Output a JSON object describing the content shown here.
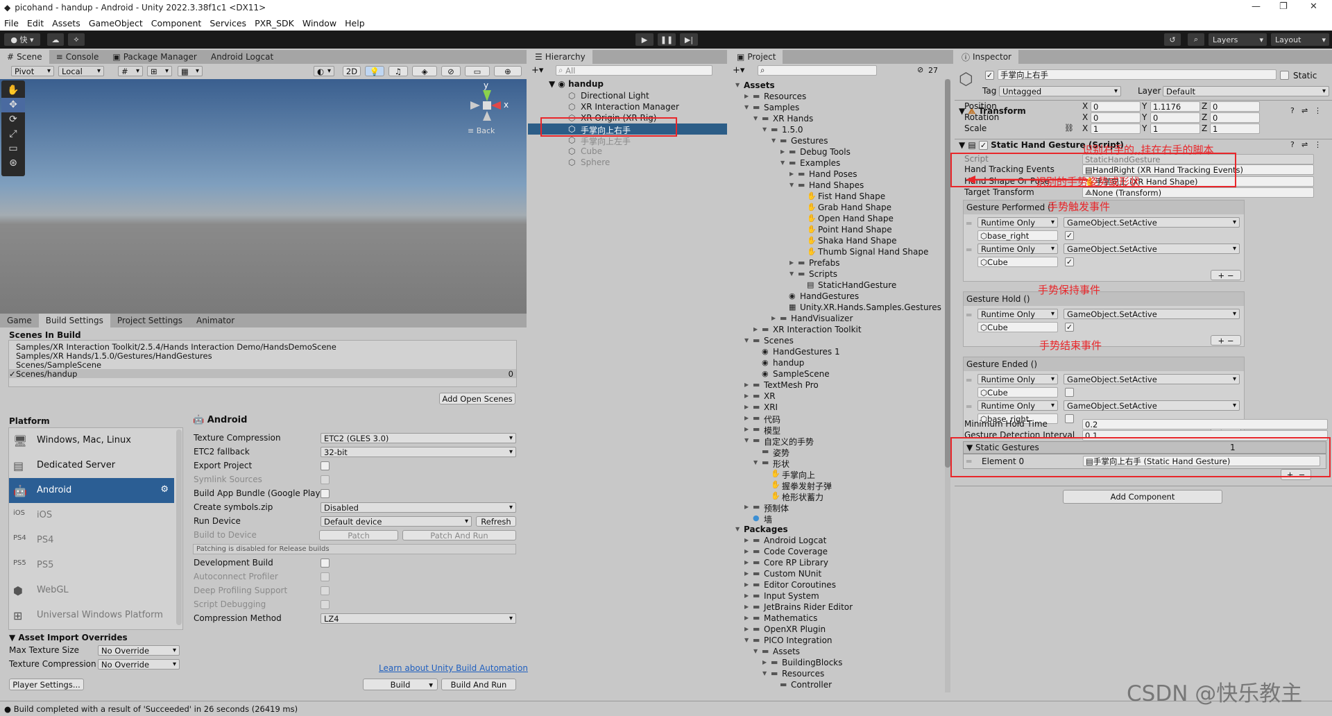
{
  "window": {
    "title": "picohand - handup - Android - Unity 2022.3.38f1c1 <DX11>",
    "controls": [
      "—",
      "❐",
      "✕"
    ]
  },
  "menu": [
    "File",
    "Edit",
    "Assets",
    "GameObject",
    "Component",
    "Services",
    "PXR_SDK",
    "Window",
    "Help"
  ],
  "toolbar": {
    "account": "快",
    "layers": "Layers",
    "layout": "Layout",
    "play": "▶",
    "pause": "❚❚",
    "step": "▶|"
  },
  "scene": {
    "tabs": [
      "Scene",
      "Console",
      "Package Manager",
      "Android Logcat"
    ],
    "pivot": "Pivot",
    "local": "Local",
    "mode2d": "2D",
    "back": "Back",
    "gizmo_y": "y",
    "gizmo_x": "x"
  },
  "build": {
    "tabs": [
      "Game",
      "Build Settings",
      "Project Settings",
      "Animator"
    ],
    "scenes_header": "Scenes In Build",
    "scenes": [
      {
        "path": "Samples/XR Interaction Toolkit/2.5.4/Hands Interaction Demo/HandsDemoScene",
        "checked": false,
        "index": ""
      },
      {
        "path": "Samples/XR Hands/1.5.0/Gestures/HandGestures",
        "checked": false,
        "index": ""
      },
      {
        "path": "Scenes/SampleScene",
        "checked": false,
        "index": ""
      },
      {
        "path": "Scenes/handup",
        "checked": true,
        "index": "0"
      }
    ],
    "add_open_scenes": "Add Open Scenes",
    "platform_header": "Platform",
    "platforms": [
      {
        "name": "Windows, Mac, Linux",
        "icon": "monitor-icon"
      },
      {
        "name": "Dedicated Server",
        "icon": "server-icon"
      },
      {
        "name": "Android",
        "icon": "android-icon"
      },
      {
        "name": "iOS",
        "icon": "ios-icon"
      },
      {
        "name": "PS4",
        "icon": "ps4-icon"
      },
      {
        "name": "PS5",
        "icon": "ps5-icon"
      },
      {
        "name": "WebGL",
        "icon": "webgl-icon"
      },
      {
        "name": "Universal Windows Platform",
        "icon": "windows-icon"
      }
    ],
    "selected_platform": "Android",
    "settings_title": "Android",
    "settings": [
      {
        "label": "Texture Compression",
        "type": "dd",
        "value": "ETC2 (GLES 3.0)"
      },
      {
        "label": "ETC2 fallback",
        "type": "dd",
        "value": "32-bit"
      },
      {
        "label": "Export Project",
        "type": "cb",
        "value": ""
      },
      {
        "label": "Symlink Sources",
        "type": "cb",
        "value": "",
        "disabled": true
      },
      {
        "label": "Build App Bundle (Google Play)",
        "type": "cb",
        "value": ""
      },
      {
        "label": "Create symbols.zip",
        "type": "dd",
        "value": "Disabled"
      },
      {
        "label": "Run Device",
        "type": "device",
        "value": "Default device"
      },
      {
        "label": "Build to Device",
        "type": "patch",
        "value": "",
        "disabled": true
      },
      {
        "label": "Patching is disabled for Release builds",
        "type": "note",
        "value": ""
      },
      {
        "label": "Development Build",
        "type": "cb",
        "value": ""
      },
      {
        "label": "Autoconnect Profiler",
        "type": "cb",
        "value": "",
        "disabled": true
      },
      {
        "label": "Deep Profiling Support",
        "type": "cb",
        "value": "",
        "disabled": true
      },
      {
        "label": "Script Debugging",
        "type": "cb",
        "value": "",
        "disabled": true
      },
      {
        "label": "Compression Method",
        "type": "dd",
        "value": "LZ4"
      }
    ],
    "refresh": "Refresh",
    "patch": "Patch",
    "patch_and_run": "Patch And Run",
    "asset_overrides": "Asset Import Overrides",
    "max_texture_size_label": "Max Texture Size",
    "max_texture_size": "No Override",
    "texture_compression_label": "Texture Compression",
    "texture_compression": "No Override",
    "learn_link": "Learn about Unity Build Automation",
    "player_settings": "Player Settings...",
    "build_btn": "Build",
    "build_and_run": "Build And Run"
  },
  "hierarchy": {
    "tab": "Hierarchy",
    "search": "All",
    "root": "handup",
    "items": [
      {
        "name": "Directional Light",
        "grey": false
      },
      {
        "name": "XR Interaction Manager",
        "grey": false
      },
      {
        "name": "XR Origin (XR Rig)",
        "grey": false
      },
      {
        "name": "手掌向上右手",
        "grey": false,
        "selected": true
      },
      {
        "name": "手掌向上左手",
        "grey": true
      },
      {
        "name": "Cube",
        "grey": true
      },
      {
        "name": "Sphere",
        "grey": true
      }
    ]
  },
  "project": {
    "tab": "Project",
    "count": "27",
    "tree": [
      {
        "d": 0,
        "t": "Assets",
        "exp": "open",
        "ic": "none",
        "b": true
      },
      {
        "d": 1,
        "t": "Resources",
        "exp": "closed",
        "ic": "folder"
      },
      {
        "d": 1,
        "t": "Samples",
        "exp": "open",
        "ic": "folder"
      },
      {
        "d": 2,
        "t": "XR Hands",
        "exp": "open",
        "ic": "folder"
      },
      {
        "d": 3,
        "t": "1.5.0",
        "exp": "open",
        "ic": "folder"
      },
      {
        "d": 4,
        "t": "Gestures",
        "exp": "open",
        "ic": "folder"
      },
      {
        "d": 5,
        "t": "Debug Tools",
        "exp": "closed",
        "ic": "folder"
      },
      {
        "d": 5,
        "t": "Examples",
        "exp": "open",
        "ic": "folder"
      },
      {
        "d": 6,
        "t": "Hand Poses",
        "exp": "closed",
        "ic": "folder"
      },
      {
        "d": 6,
        "t": "Hand Shapes",
        "exp": "open",
        "ic": "folder"
      },
      {
        "d": 7,
        "t": "Fist Hand Shape",
        "exp": "none",
        "ic": "hand"
      },
      {
        "d": 7,
        "t": "Grab Hand Shape",
        "exp": "none",
        "ic": "hand"
      },
      {
        "d": 7,
        "t": "Open Hand Shape",
        "exp": "none",
        "ic": "hand"
      },
      {
        "d": 7,
        "t": "Point Hand Shape",
        "exp": "none",
        "ic": "hand"
      },
      {
        "d": 7,
        "t": "Shaka Hand Shape",
        "exp": "none",
        "ic": "hand"
      },
      {
        "d": 7,
        "t": "Thumb Signal Hand Shape",
        "exp": "none",
        "ic": "hand"
      },
      {
        "d": 6,
        "t": "Prefabs",
        "exp": "closed",
        "ic": "folder"
      },
      {
        "d": 6,
        "t": "Scripts",
        "exp": "open",
        "ic": "folder"
      },
      {
        "d": 7,
        "t": "StaticHandGesture",
        "exp": "none",
        "ic": "script"
      },
      {
        "d": 5,
        "t": "HandGestures",
        "exp": "none",
        "ic": "unity"
      },
      {
        "d": 5,
        "t": "Unity.XR.Hands.Samples.Gestures",
        "exp": "none",
        "ic": "asm"
      },
      {
        "d": 4,
        "t": "HandVisualizer",
        "exp": "closed",
        "ic": "folder"
      },
      {
        "d": 2,
        "t": "XR Interaction Toolkit",
        "exp": "closed",
        "ic": "folder"
      },
      {
        "d": 1,
        "t": "Scenes",
        "exp": "open",
        "ic": "folder"
      },
      {
        "d": 2,
        "t": "HandGestures 1",
        "exp": "none",
        "ic": "unity"
      },
      {
        "d": 2,
        "t": "handup",
        "exp": "none",
        "ic": "unity"
      },
      {
        "d": 2,
        "t": "SampleScene",
        "exp": "none",
        "ic": "unity"
      },
      {
        "d": 1,
        "t": "TextMesh Pro",
        "exp": "closed",
        "ic": "folder"
      },
      {
        "d": 1,
        "t": "XR",
        "exp": "closed",
        "ic": "folder"
      },
      {
        "d": 1,
        "t": "XRI",
        "exp": "closed",
        "ic": "folder"
      },
      {
        "d": 1,
        "t": "代码",
        "exp": "closed",
        "ic": "folder"
      },
      {
        "d": 1,
        "t": "模型",
        "exp": "closed",
        "ic": "folder"
      },
      {
        "d": 1,
        "t": "自定义的手势",
        "exp": "open",
        "ic": "folder"
      },
      {
        "d": 2,
        "t": "姿势",
        "exp": "none",
        "ic": "folder"
      },
      {
        "d": 2,
        "t": "形状",
        "exp": "open",
        "ic": "folder"
      },
      {
        "d": 3,
        "t": "手掌向上",
        "exp": "none",
        "ic": "hand"
      },
      {
        "d": 3,
        "t": "握拳发射子弹",
        "exp": "none",
        "ic": "hand"
      },
      {
        "d": 3,
        "t": "枪形状蓄力",
        "exp": "none",
        "ic": "hand"
      },
      {
        "d": 1,
        "t": "预制体",
        "exp": "closed",
        "ic": "folder"
      },
      {
        "d": 1,
        "t": "墙",
        "exp": "none",
        "ic": "material"
      },
      {
        "d": 0,
        "t": "Packages",
        "exp": "open",
        "ic": "none",
        "b": true
      },
      {
        "d": 1,
        "t": "Android Logcat",
        "exp": "closed",
        "ic": "folder"
      },
      {
        "d": 1,
        "t": "Code Coverage",
        "exp": "closed",
        "ic": "folder"
      },
      {
        "d": 1,
        "t": "Core RP Library",
        "exp": "closed",
        "ic": "folder"
      },
      {
        "d": 1,
        "t": "Custom NUnit",
        "exp": "closed",
        "ic": "folder"
      },
      {
        "d": 1,
        "t": "Editor Coroutines",
        "exp": "closed",
        "ic": "folder"
      },
      {
        "d": 1,
        "t": "Input System",
        "exp": "closed",
        "ic": "folder"
      },
      {
        "d": 1,
        "t": "JetBrains Rider Editor",
        "exp": "closed",
        "ic": "folder"
      },
      {
        "d": 1,
        "t": "Mathematics",
        "exp": "closed",
        "ic": "folder"
      },
      {
        "d": 1,
        "t": "OpenXR Plugin",
        "exp": "closed",
        "ic": "folder"
      },
      {
        "d": 1,
        "t": "PICO Integration",
        "exp": "open",
        "ic": "folder"
      },
      {
        "d": 2,
        "t": "Assets",
        "exp": "open",
        "ic": "folder"
      },
      {
        "d": 3,
        "t": "BuildingBlocks",
        "exp": "closed",
        "ic": "folder"
      },
      {
        "d": 3,
        "t": "Resources",
        "exp": "open",
        "ic": "folder"
      },
      {
        "d": 4,
        "t": "Controller",
        "exp": "none",
        "ic": "folder"
      }
    ]
  },
  "inspector": {
    "tab": "Inspector",
    "object_name": "手掌向上右手",
    "static": "Static",
    "tag_label": "Tag",
    "tag": "Untagged",
    "layer_label": "Layer",
    "layer": "Default",
    "transform": {
      "title": "Transform",
      "rows": [
        {
          "label": "Position",
          "x": "0",
          "y": "1.1176",
          "z": "0"
        },
        {
          "label": "Rotation",
          "x": "0",
          "y": "0",
          "z": "0"
        },
        {
          "label": "Scale",
          "x": "1",
          "y": "1",
          "z": "1"
        }
      ]
    },
    "component": {
      "title": "Static Hand Gesture (Script)",
      "script_label": "Script",
      "script": "StaticHandGesture",
      "hte_label": "Hand Tracking Events",
      "hte": "HandRight (XR Hand Tracking Events)",
      "hsp_label": "Hand Shape Or Pose",
      "hsp": "手掌向上 (XR Hand Shape)",
      "tt_label": "Target Transform",
      "tt": "None (Transform)",
      "events": [
        {
          "title": "Gesture Performed ()",
          "entries": [
            {
              "mode": "Runtime Only",
              "func": "GameObject.SetActive",
              "obj": "base_right",
              "checked": true
            },
            {
              "mode": "Runtime Only",
              "func": "GameObject.SetActive",
              "obj": "Cube",
              "checked": true
            }
          ]
        },
        {
          "title": "Gesture Hold ()",
          "entries": [
            {
              "mode": "Runtime Only",
              "func": "GameObject.SetActive",
              "obj": "Cube",
              "checked": true
            }
          ]
        },
        {
          "title": "Gesture Ended ()",
          "entries": [
            {
              "mode": "Runtime Only",
              "func": "GameObject.SetActive",
              "obj": "Cube",
              "checked": false
            },
            {
              "mode": "Runtime Only",
              "func": "GameObject.SetActive",
              "obj": "base_right",
              "checked": false
            }
          ]
        }
      ],
      "min_hold_label": "Minimum Hold Time",
      "min_hold": "0.2",
      "interval_label": "Gesture Detection Interval",
      "interval": "0.1",
      "static_gestures_label": "Static Gestures",
      "static_gestures_count": "1",
      "element_label": "Element 0",
      "element_value": "手掌向上右手 (Static Hand Gesture)"
    },
    "add_component": "Add Component"
  },
  "annotations": {
    "script_note": "识别右手的,,挂在右手的脚本",
    "shape_note": "识别的手势姿势或形状",
    "performed_note": "手势触发事件",
    "hold_note": "手势保持事件",
    "ended_note": "手势结束事件"
  },
  "status": "Build completed with a result of 'Succeeded' in 26 seconds (26419 ms)",
  "watermark": "CSDN @快乐教主"
}
